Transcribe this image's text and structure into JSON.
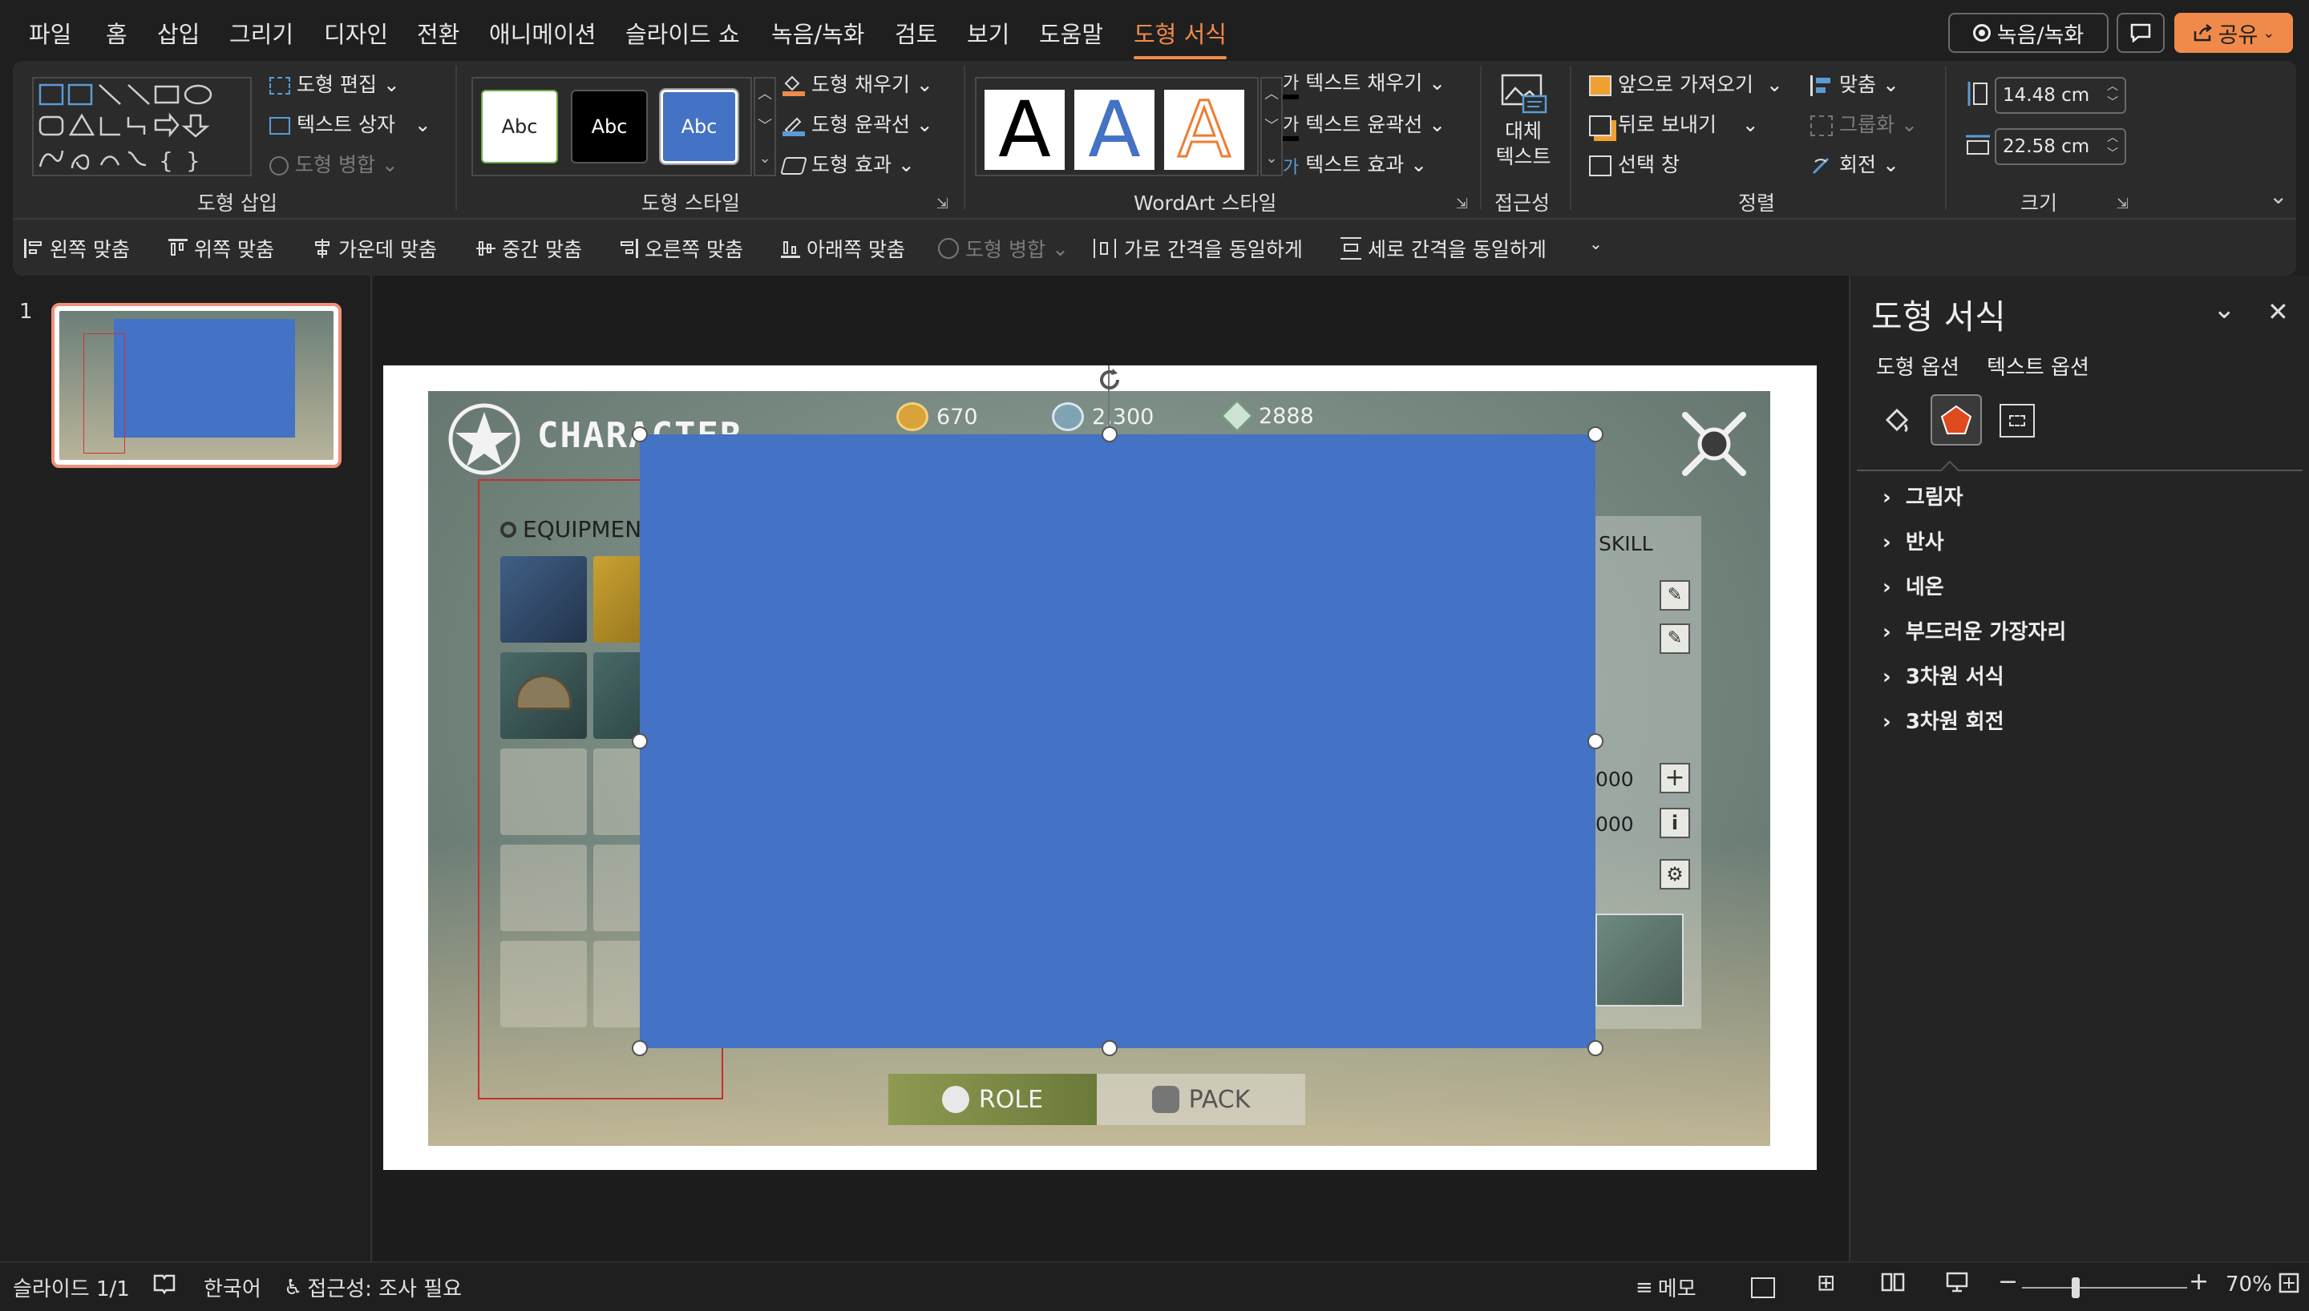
{
  "menu": {
    "tabs": [
      "파일",
      "홈",
      "삽입",
      "그리기",
      "디자인",
      "전환",
      "애니메이션",
      "슬라이드 쇼",
      "녹음/녹화",
      "검토",
      "보기",
      "도움말",
      "도형 서식"
    ],
    "active_tab": "도형 서식",
    "record_button": "녹음/녹화",
    "share_button": "공유"
  },
  "ribbon": {
    "insert_shapes": {
      "edit_shape": "도형 편집",
      "text_box": "텍스트 상자",
      "merge_shapes": "도형 병합",
      "label": "도형 삽입"
    },
    "shape_styles": {
      "preset_text": "Abc",
      "fill": "도형 채우기",
      "outline": "도형 윤곽선",
      "effects": "도형 효과",
      "label": "도형 스타일"
    },
    "wordart": {
      "letter": "A",
      "text_fill": "텍스트 채우기",
      "text_outline": "텍스트 윤곽선",
      "text_effects": "텍스트 효과",
      "label": "WordArt 스타일"
    },
    "accessibility": {
      "alt_text_line1": "대체",
      "alt_text_line2": "텍스트",
      "label": "접근성"
    },
    "arrange": {
      "bring_forward": "앞으로 가져오기",
      "send_backward": "뒤로 보내기",
      "selection_pane": "선택 창",
      "align": "맞춤",
      "group": "그룹화",
      "rotate": "회전",
      "label": "정렬"
    },
    "size": {
      "height": "14.48 cm",
      "width": "22.58 cm",
      "label": "크기"
    }
  },
  "align_bar": [
    "왼쪽 맞춤",
    "위쪽 맞춤",
    "가운데 맞춤",
    "중간 맞춤",
    "오른쪽 맞춤",
    "아래쪽 맞춤",
    "도형 병합",
    "가로 간격을 동일하게",
    "세로 간격을 동일하게"
  ],
  "thumbnails": {
    "slide_number": "1"
  },
  "slide": {
    "title_text": "CHARACTER",
    "currency": [
      "670",
      "2,300",
      "2888"
    ],
    "equipment_label": "EQUIPMENT",
    "skill_label": "SKILL",
    "stat_values": [
      "000",
      "000"
    ],
    "role_tab": "ROLE",
    "pack_tab": "PACK",
    "shape_color": "#4472c4"
  },
  "format_pane": {
    "title": "도형 서식",
    "tab_shape": "도형 옵션",
    "tab_text": "텍스트 옵션",
    "sections": [
      "그림자",
      "반사",
      "네온",
      "부드러운 가장자리",
      "3차원 서식",
      "3차원 회전"
    ]
  },
  "status": {
    "slide_info": "슬라이드 1/1",
    "language": "한국어",
    "accessibility": "접근성: 조사 필요",
    "notes": "메모",
    "zoom": "70%"
  },
  "colors": {
    "accent": "#f08a4b",
    "shape_blue": "#4472c4"
  }
}
